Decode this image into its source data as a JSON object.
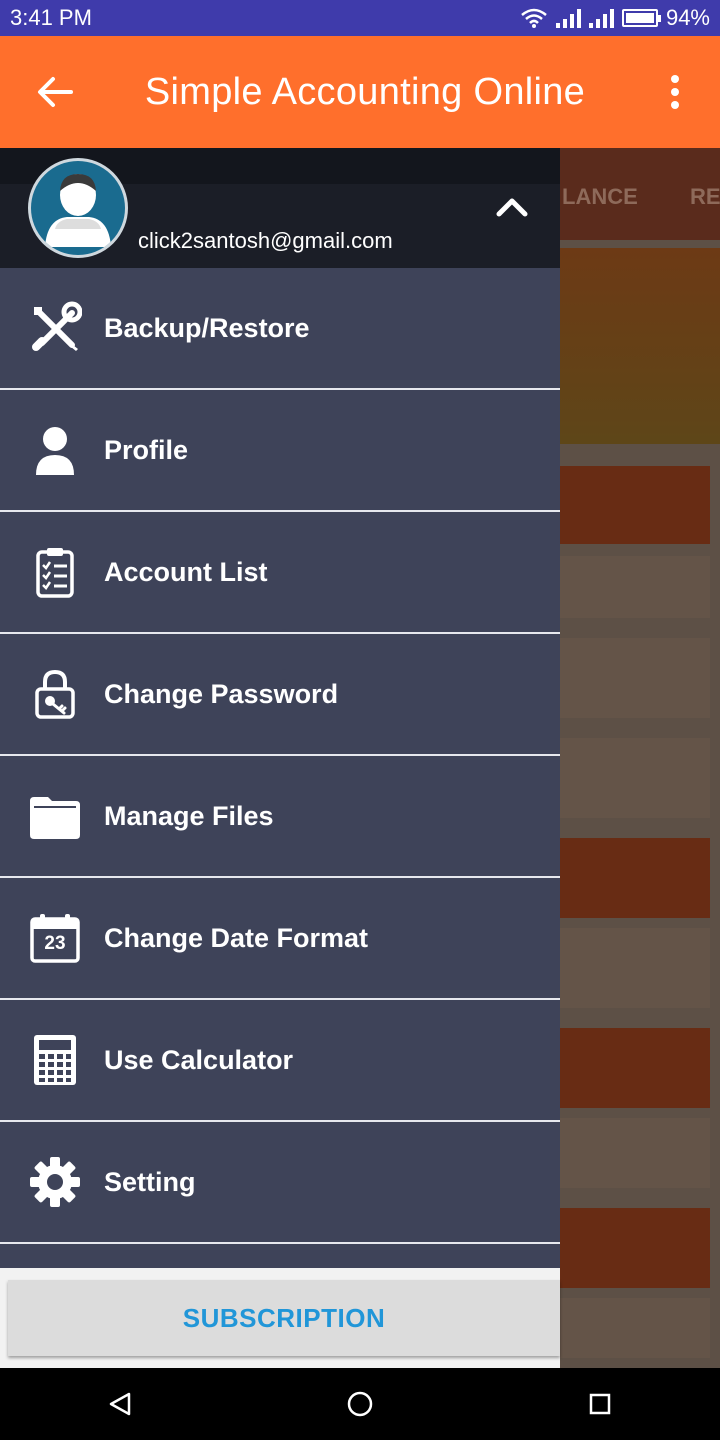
{
  "status_bar": {
    "time": "3:41 PM",
    "battery": "94%"
  },
  "app_bar": {
    "title": "Simple Accounting Online"
  },
  "background": {
    "tab_partial_1": "LANCE",
    "tab_partial_2": "RE"
  },
  "drawer": {
    "email": "click2santosh@gmail.com",
    "items": [
      {
        "label": "Backup/Restore",
        "icon": "tools-icon"
      },
      {
        "label": "Profile",
        "icon": "person-icon"
      },
      {
        "label": "Account List",
        "icon": "clipboard-list-icon"
      },
      {
        "label": "Change Password",
        "icon": "lock-key-icon"
      },
      {
        "label": "Manage Files",
        "icon": "folder-icon"
      },
      {
        "label": "Change Date Format",
        "icon": "calendar-icon"
      },
      {
        "label": "Use Calculator",
        "icon": "calculator-icon"
      },
      {
        "label": "Setting",
        "icon": "gear-icon"
      }
    ],
    "calendar_day": "23",
    "subscription_label": "SUBSCRIPTION"
  },
  "colors": {
    "status_bar": "#3f3bab",
    "app_bar": "#ff6f2c",
    "drawer": "#3e4359",
    "accent_link": "#2196d8"
  }
}
